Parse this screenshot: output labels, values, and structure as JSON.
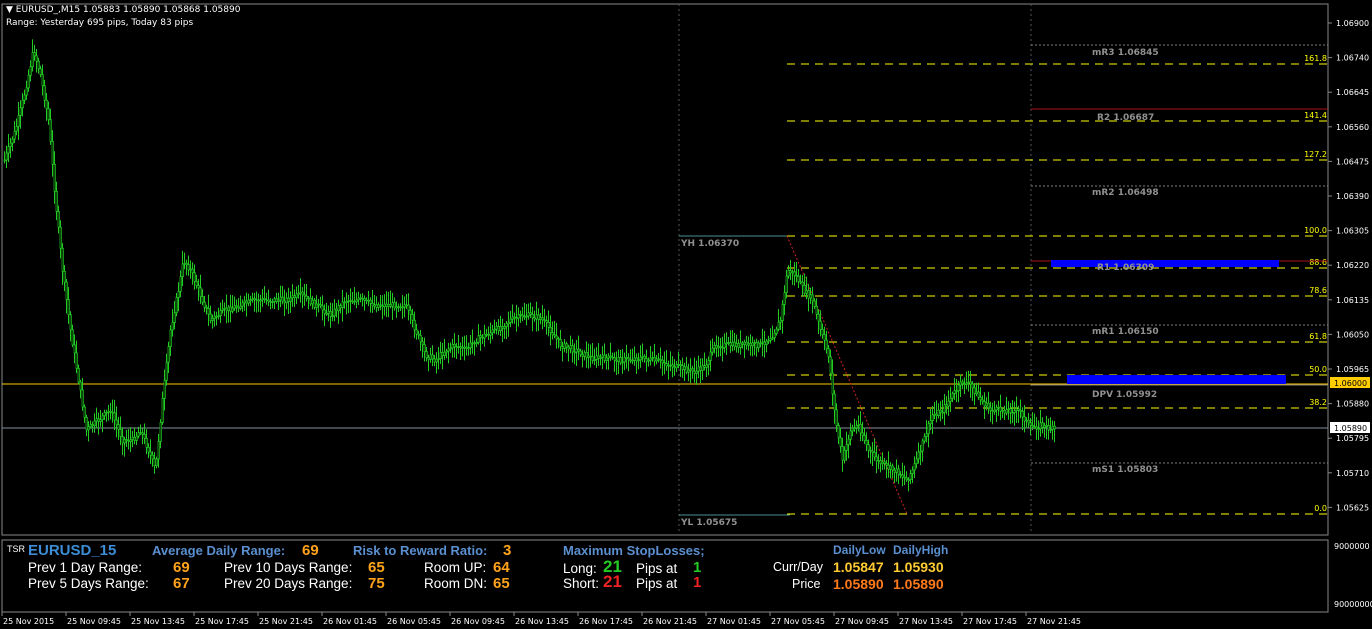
{
  "header": {
    "title": "EURUSD_,M15  1.05883 1.05890 1.05868 1.05890",
    "range": "Range: Yesterday 695 pips, Today 83 pips"
  },
  "price_axis": {
    "labels": [
      "1.06900",
      "1.06740",
      "1.06645",
      "1.06560",
      "1.06475",
      "1.06390",
      "1.06305",
      "1.06220",
      "1.06135",
      "1.06050",
      "1.05965",
      "1.05880",
      "1.05795",
      "1.05710",
      "1.05625"
    ],
    "current": "1.05890",
    "level": "1.06000",
    "ind_top": "9000000",
    "ind_bottom": "90000000"
  },
  "time_axis": [
    "25 Nov 2015",
    "25 Nov 09:45",
    "25 Nov 13:45",
    "25 Nov 17:45",
    "25 Nov 21:45",
    "26 Nov 01:45",
    "26 Nov 05:45",
    "26 Nov 09:45",
    "26 Nov 13:45",
    "26 Nov 17:45",
    "26 Nov 21:45",
    "27 Nov 01:45",
    "27 Nov 05:45",
    "27 Nov 09:45",
    "27 Nov 13:45",
    "27 Nov 17:45",
    "27 Nov 21:45"
  ],
  "levels": {
    "yh": "YH 1.06370",
    "yl": "YL 1.05675",
    "pivots": [
      "mR3 1.06845",
      "R2 1.06687",
      "mR2 1.06498",
      "R1 1.06309",
      "mR1 1.06150",
      "DPV 1.05992",
      "mS1 1.05803"
    ],
    "fibs": [
      "161.8",
      "141.4",
      "127.2",
      "100.0",
      "88.6",
      "78.6",
      "61.8",
      "50.0",
      "38.2",
      "0.0"
    ]
  },
  "panel": {
    "tsr": "TSR",
    "symbol": "EURUSD_15",
    "adr_label": "Average Daily Range:",
    "adr_value": "69",
    "rr_label": "Risk to Reward Ratio:",
    "rr_value": "3",
    "prev1_label": "Prev 1 Day Range:",
    "prev1_value": "69",
    "prev5_label": "Prev 5 Days Range:",
    "prev5_value": "67",
    "prev10_label": "Prev 10 Days Range:",
    "prev10_value": "65",
    "prev20_label": "Prev 20 Days Range:",
    "prev20_value": "75",
    "roomup_label": "Room UP:",
    "roomup_value": "64",
    "roomdn_label": "Room DN:",
    "roomdn_value": "65",
    "maxsl_label": "Maximum  StopLosses;",
    "long_label": "Long:",
    "long_value": "21",
    "long_pips_label": "Pips at",
    "long_pips_value": "1",
    "short_label": "Short:",
    "short_value": "21",
    "short_pips_label": "Pips at",
    "short_pips_value": "1",
    "dlow_label": "DailyLow",
    "dhigh_label": "DailyHigh",
    "currday_label": "Curr/Day",
    "price_label": "Price",
    "currday_low": "1.05847",
    "currday_high": "1.05930",
    "price_low": "1.05890",
    "price_high": "1.05890"
  },
  "colors": {
    "candle": "#22cc22",
    "fib": "#ffff00",
    "pivot": "#808080",
    "r2": "#aa1111",
    "r1box": "#0000ff",
    "yellowline": "#ffcc00",
    "currentline": "#7f8fa0"
  }
}
